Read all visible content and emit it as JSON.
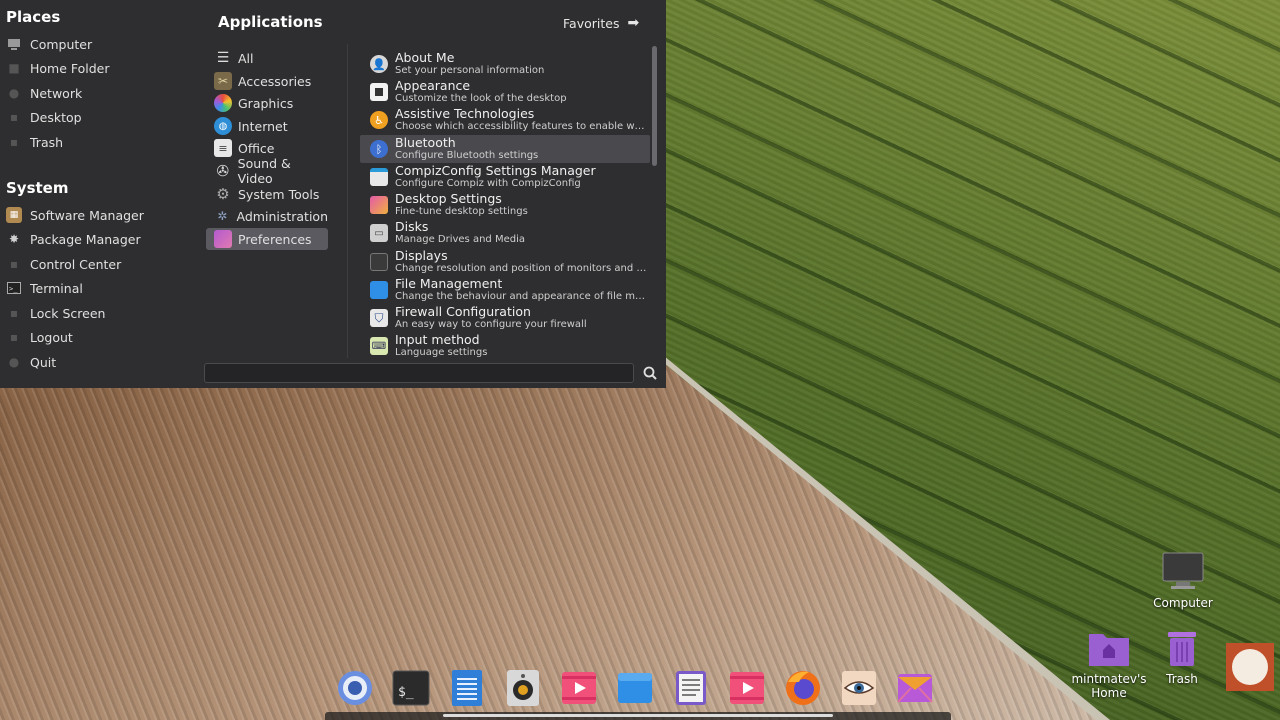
{
  "places": {
    "title": "Places",
    "items": [
      {
        "label": "Computer",
        "icon": "computer-icon"
      },
      {
        "label": "Home Folder",
        "icon": "home-folder-icon"
      },
      {
        "label": "Network",
        "icon": "network-icon"
      },
      {
        "label": "Desktop",
        "icon": "desktop-icon"
      },
      {
        "label": "Trash",
        "icon": "trash-icon"
      }
    ]
  },
  "system": {
    "title": "System",
    "items": [
      {
        "label": "Software Manager",
        "icon": "software-manager-icon"
      },
      {
        "label": "Package Manager",
        "icon": "package-manager-icon"
      },
      {
        "label": "Control Center",
        "icon": "control-center-icon"
      },
      {
        "label": "Terminal",
        "icon": "terminal-icon"
      },
      {
        "label": "Lock Screen",
        "icon": "lock-screen-icon"
      },
      {
        "label": "Logout",
        "icon": "logout-icon"
      },
      {
        "label": "Quit",
        "icon": "quit-icon"
      }
    ]
  },
  "applications": {
    "title": "Applications",
    "favorites_label": "Favorites",
    "categories": [
      {
        "label": "All",
        "icon": "list-icon"
      },
      {
        "label": "Accessories",
        "icon": "accessories-icon"
      },
      {
        "label": "Graphics",
        "icon": "graphics-icon"
      },
      {
        "label": "Internet",
        "icon": "internet-icon"
      },
      {
        "label": "Office",
        "icon": "office-icon"
      },
      {
        "label": "Sound & Video",
        "icon": "sound-video-icon"
      },
      {
        "label": "System Tools",
        "icon": "system-tools-icon"
      },
      {
        "label": "Administration",
        "icon": "administration-icon"
      },
      {
        "label": "Preferences",
        "icon": "preferences-icon"
      }
    ],
    "selected_category": "Preferences",
    "apps": [
      {
        "name": "About Me",
        "desc": "Set your personal information",
        "icon": "about-me-icon"
      },
      {
        "name": "Appearance",
        "desc": "Customize the look of the desktop",
        "icon": "appearance-icon"
      },
      {
        "name": "Assistive Technologies",
        "desc": "Choose which accessibility features to enable whe...",
        "icon": "accessibility-icon"
      },
      {
        "name": "Bluetooth",
        "desc": "Configure Bluetooth settings",
        "icon": "bluetooth-icon"
      },
      {
        "name": "CompizConfig Settings Manager",
        "desc": "Configure Compiz with CompizConfig",
        "icon": "compizconfig-icon"
      },
      {
        "name": "Desktop Settings",
        "desc": "Fine-tune desktop settings",
        "icon": "desktop-settings-icon"
      },
      {
        "name": "Disks",
        "desc": "Manage Drives and Media",
        "icon": "disks-icon"
      },
      {
        "name": "Displays",
        "desc": "Change resolution and position of monitors and pr...",
        "icon": "displays-icon"
      },
      {
        "name": "File Management",
        "desc": "Change the behaviour and appearance of file mana...",
        "icon": "file-management-icon"
      },
      {
        "name": "Firewall Configuration",
        "desc": "An easy way to configure your firewall",
        "icon": "firewall-icon"
      },
      {
        "name": "Input method",
        "desc": "Language settings",
        "icon": "input-method-icon"
      }
    ],
    "hovered_app": "Bluetooth"
  },
  "search": {
    "value": "",
    "placeholder": ""
  },
  "desktop_icons": [
    {
      "label": "Computer",
      "icon": "computer-icon"
    },
    {
      "label": "mintmatev's Home",
      "icon": "home-folder-icon"
    },
    {
      "label": "Trash",
      "icon": "trash-icon"
    }
  ],
  "dock": [
    {
      "icon": "browser-globe-icon"
    },
    {
      "icon": "terminal-icon"
    },
    {
      "icon": "text-editor-icon"
    },
    {
      "icon": "speaker-icon"
    },
    {
      "icon": "media-player-icon"
    },
    {
      "icon": "file-manager-icon"
    },
    {
      "icon": "notes-icon"
    },
    {
      "icon": "video-player-icon"
    },
    {
      "icon": "firefox-icon"
    },
    {
      "icon": "eye-viewer-icon"
    },
    {
      "icon": "mail-icon"
    }
  ],
  "colors": {
    "menu_bg": "#2e2e30",
    "selected_bg": "#5a5a60",
    "hover_bg": "#4a4a4e"
  }
}
